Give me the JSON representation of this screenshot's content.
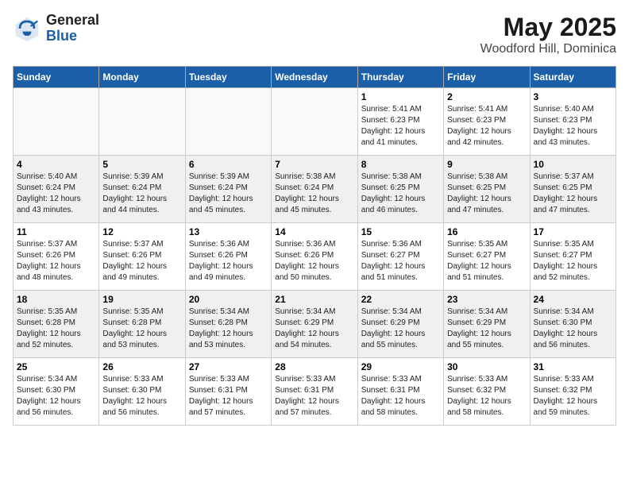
{
  "header": {
    "logo_general": "General",
    "logo_blue": "Blue",
    "month_year": "May 2025",
    "location": "Woodford Hill, Dominica"
  },
  "days_of_week": [
    "Sunday",
    "Monday",
    "Tuesday",
    "Wednesday",
    "Thursday",
    "Friday",
    "Saturday"
  ],
  "weeks": [
    [
      {
        "day": "",
        "info": ""
      },
      {
        "day": "",
        "info": ""
      },
      {
        "day": "",
        "info": ""
      },
      {
        "day": "",
        "info": ""
      },
      {
        "day": "1",
        "info": "Sunrise: 5:41 AM\nSunset: 6:23 PM\nDaylight: 12 hours\nand 41 minutes."
      },
      {
        "day": "2",
        "info": "Sunrise: 5:41 AM\nSunset: 6:23 PM\nDaylight: 12 hours\nand 42 minutes."
      },
      {
        "day": "3",
        "info": "Sunrise: 5:40 AM\nSunset: 6:23 PM\nDaylight: 12 hours\nand 43 minutes."
      }
    ],
    [
      {
        "day": "4",
        "info": "Sunrise: 5:40 AM\nSunset: 6:24 PM\nDaylight: 12 hours\nand 43 minutes."
      },
      {
        "day": "5",
        "info": "Sunrise: 5:39 AM\nSunset: 6:24 PM\nDaylight: 12 hours\nand 44 minutes."
      },
      {
        "day": "6",
        "info": "Sunrise: 5:39 AM\nSunset: 6:24 PM\nDaylight: 12 hours\nand 45 minutes."
      },
      {
        "day": "7",
        "info": "Sunrise: 5:38 AM\nSunset: 6:24 PM\nDaylight: 12 hours\nand 45 minutes."
      },
      {
        "day": "8",
        "info": "Sunrise: 5:38 AM\nSunset: 6:25 PM\nDaylight: 12 hours\nand 46 minutes."
      },
      {
        "day": "9",
        "info": "Sunrise: 5:38 AM\nSunset: 6:25 PM\nDaylight: 12 hours\nand 47 minutes."
      },
      {
        "day": "10",
        "info": "Sunrise: 5:37 AM\nSunset: 6:25 PM\nDaylight: 12 hours\nand 47 minutes."
      }
    ],
    [
      {
        "day": "11",
        "info": "Sunrise: 5:37 AM\nSunset: 6:26 PM\nDaylight: 12 hours\nand 48 minutes."
      },
      {
        "day": "12",
        "info": "Sunrise: 5:37 AM\nSunset: 6:26 PM\nDaylight: 12 hours\nand 49 minutes."
      },
      {
        "day": "13",
        "info": "Sunrise: 5:36 AM\nSunset: 6:26 PM\nDaylight: 12 hours\nand 49 minutes."
      },
      {
        "day": "14",
        "info": "Sunrise: 5:36 AM\nSunset: 6:26 PM\nDaylight: 12 hours\nand 50 minutes."
      },
      {
        "day": "15",
        "info": "Sunrise: 5:36 AM\nSunset: 6:27 PM\nDaylight: 12 hours\nand 51 minutes."
      },
      {
        "day": "16",
        "info": "Sunrise: 5:35 AM\nSunset: 6:27 PM\nDaylight: 12 hours\nand 51 minutes."
      },
      {
        "day": "17",
        "info": "Sunrise: 5:35 AM\nSunset: 6:27 PM\nDaylight: 12 hours\nand 52 minutes."
      }
    ],
    [
      {
        "day": "18",
        "info": "Sunrise: 5:35 AM\nSunset: 6:28 PM\nDaylight: 12 hours\nand 52 minutes."
      },
      {
        "day": "19",
        "info": "Sunrise: 5:35 AM\nSunset: 6:28 PM\nDaylight: 12 hours\nand 53 minutes."
      },
      {
        "day": "20",
        "info": "Sunrise: 5:34 AM\nSunset: 6:28 PM\nDaylight: 12 hours\nand 53 minutes."
      },
      {
        "day": "21",
        "info": "Sunrise: 5:34 AM\nSunset: 6:29 PM\nDaylight: 12 hours\nand 54 minutes."
      },
      {
        "day": "22",
        "info": "Sunrise: 5:34 AM\nSunset: 6:29 PM\nDaylight: 12 hours\nand 55 minutes."
      },
      {
        "day": "23",
        "info": "Sunrise: 5:34 AM\nSunset: 6:29 PM\nDaylight: 12 hours\nand 55 minutes."
      },
      {
        "day": "24",
        "info": "Sunrise: 5:34 AM\nSunset: 6:30 PM\nDaylight: 12 hours\nand 56 minutes."
      }
    ],
    [
      {
        "day": "25",
        "info": "Sunrise: 5:34 AM\nSunset: 6:30 PM\nDaylight: 12 hours\nand 56 minutes."
      },
      {
        "day": "26",
        "info": "Sunrise: 5:33 AM\nSunset: 6:30 PM\nDaylight: 12 hours\nand 56 minutes."
      },
      {
        "day": "27",
        "info": "Sunrise: 5:33 AM\nSunset: 6:31 PM\nDaylight: 12 hours\nand 57 minutes."
      },
      {
        "day": "28",
        "info": "Sunrise: 5:33 AM\nSunset: 6:31 PM\nDaylight: 12 hours\nand 57 minutes."
      },
      {
        "day": "29",
        "info": "Sunrise: 5:33 AM\nSunset: 6:31 PM\nDaylight: 12 hours\nand 58 minutes."
      },
      {
        "day": "30",
        "info": "Sunrise: 5:33 AM\nSunset: 6:32 PM\nDaylight: 12 hours\nand 58 minutes."
      },
      {
        "day": "31",
        "info": "Sunrise: 5:33 AM\nSunset: 6:32 PM\nDaylight: 12 hours\nand 59 minutes."
      }
    ]
  ]
}
